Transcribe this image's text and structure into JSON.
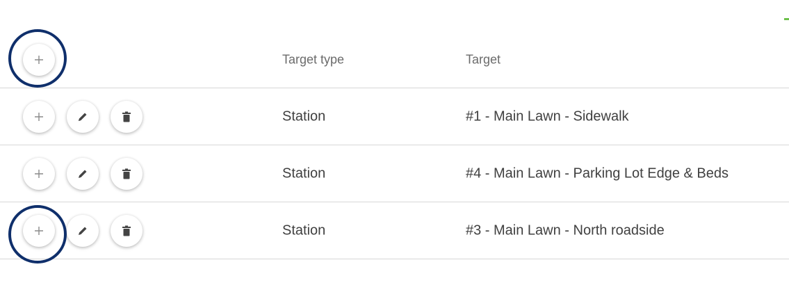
{
  "columns": {
    "target_type": "Target type",
    "target": "Target"
  },
  "rows": [
    {
      "target_type": "Station",
      "target": "#1 - Main Lawn - Sidewalk"
    },
    {
      "target_type": "Station",
      "target": "#4 - Main Lawn - Parking Lot Edge & Beds"
    },
    {
      "target_type": "Station",
      "target": "#3 - Main Lawn - North roadside"
    }
  ],
  "icons": {
    "add": "plus-icon",
    "edit": "pencil-icon",
    "delete": "trash-icon"
  },
  "colors": {
    "annotation_ring": "#0f2f6b",
    "accent": "#6cc04a",
    "divider": "#d7d7d7"
  }
}
